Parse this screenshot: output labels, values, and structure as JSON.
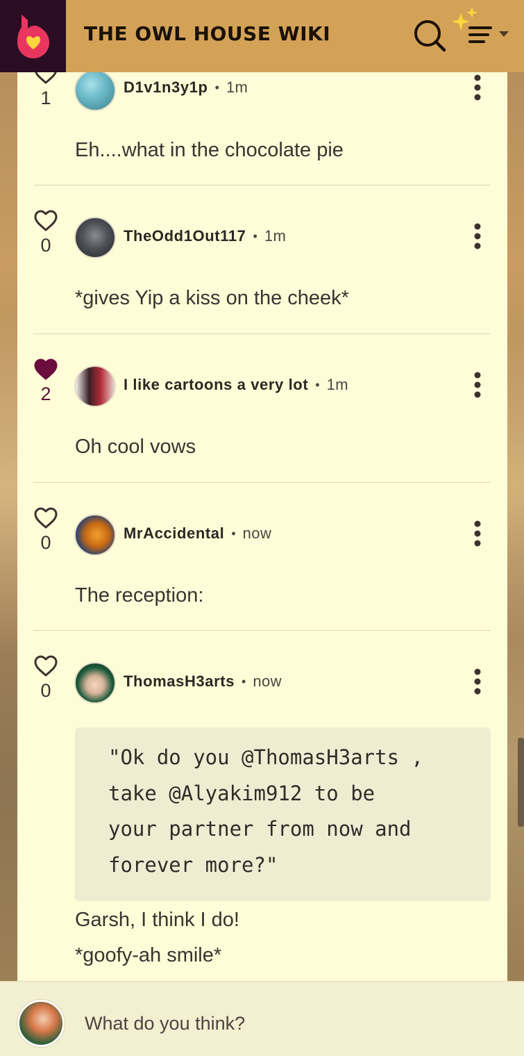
{
  "header": {
    "site_title": "THE OWL HOUSE WIKI",
    "logo_icon": "fandom-flame-icon",
    "search_icon": "search-icon",
    "menu_icon": "sparkle-menu-icon",
    "bg_color": "#d4a257",
    "logo_bg_color": "#2a0d22",
    "logo_color": "#e8365f"
  },
  "comments": [
    {
      "username": "D1v1n3y1p",
      "separator": "•",
      "time": "1m",
      "likes": "1",
      "liked": false,
      "text": "Eh....what in the chocolate pie"
    },
    {
      "username": "TheOdd1Out117",
      "separator": "•",
      "time": "1m",
      "likes": "0",
      "liked": false,
      "text": "*gives Yip a kiss on the cheek*"
    },
    {
      "username": "I like cartoons a very lot",
      "separator": "•",
      "time": "1m",
      "likes": "2",
      "liked": true,
      "text": "Oh cool vows"
    },
    {
      "username": "MrAccidental",
      "separator": "•",
      "time": "now",
      "likes": "0",
      "liked": false,
      "text": "The reception:"
    },
    {
      "username": "ThomasH3arts",
      "separator": "•",
      "time": "now",
      "likes": "0",
      "liked": false,
      "quote_lines": [
        "\"Ok do you @ThomasH3arts ,",
        "take @Alyakim912 to be",
        "your partner from now and",
        "forever more?\""
      ],
      "lines": [
        "Garsh, I think I do!",
        "*goofy-ah smile*"
      ]
    }
  ],
  "reply": {
    "placeholder": "What do you think?"
  },
  "colors": {
    "card_bg": "#fffcd8",
    "liked_heart": "#6b0d3d",
    "text": "#3a3330"
  }
}
